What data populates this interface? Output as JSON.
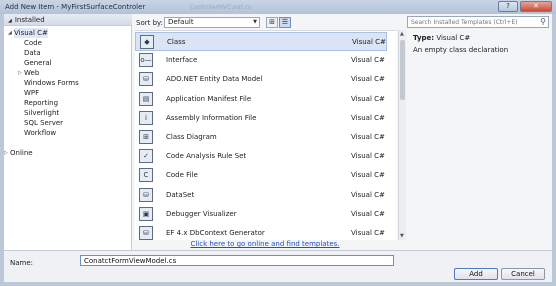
{
  "window": {
    "title": "Add New Item - MyFirstSurfaceControler",
    "background_title": "ControlerMVCunit.cs"
  },
  "left": {
    "installed_label": "Installed",
    "tree": [
      {
        "label": "Visual C#",
        "level": 1,
        "expander": "open",
        "selected": true
      },
      {
        "label": "Code",
        "level": 2,
        "expander": "none"
      },
      {
        "label": "Data",
        "level": 2,
        "expander": "none"
      },
      {
        "label": "General",
        "level": 2,
        "expander": "none"
      },
      {
        "label": "Web",
        "level": 2,
        "expander": "closed"
      },
      {
        "label": "Windows Forms",
        "level": 2,
        "expander": "none"
      },
      {
        "label": "WPF",
        "level": 2,
        "expander": "none"
      },
      {
        "label": "Reporting",
        "level": 2,
        "expander": "none"
      },
      {
        "label": "Silverlight",
        "level": 2,
        "expander": "none"
      },
      {
        "label": "SQL Server",
        "level": 2,
        "expander": "none"
      },
      {
        "label": "Workflow",
        "level": 2,
        "expander": "none"
      },
      {
        "label": "",
        "level": 0,
        "expander": "spacer"
      },
      {
        "label": "Online",
        "level": 0,
        "expander": "closed"
      }
    ]
  },
  "toolbar": {
    "sort_label": "Sort by:",
    "sort_value": "Default"
  },
  "search": {
    "placeholder": "Search Installed Templates (Ctrl+E)"
  },
  "templates": [
    {
      "name": "Class",
      "lang": "Visual C#",
      "icon": "class-icon",
      "glyph": "◆",
      "selected": true
    },
    {
      "name": "Interface",
      "lang": "Visual C#",
      "icon": "interface-icon",
      "glyph": "o—"
    },
    {
      "name": "ADO.NET Entity Data Model",
      "lang": "Visual C#",
      "icon": "entity-model-icon",
      "glyph": "⛁"
    },
    {
      "name": "Application Manifest File",
      "lang": "Visual C#",
      "icon": "manifest-icon",
      "glyph": "▤"
    },
    {
      "name": "Assembly Information File",
      "lang": "Visual C#",
      "icon": "assembly-info-icon",
      "glyph": "i"
    },
    {
      "name": "Class Diagram",
      "lang": "Visual C#",
      "icon": "class-diagram-icon",
      "glyph": "⊞"
    },
    {
      "name": "Code Analysis Rule Set",
      "lang": "Visual C#",
      "icon": "rule-set-icon",
      "glyph": "✓"
    },
    {
      "name": "Code File",
      "lang": "Visual C#",
      "icon": "code-file-icon",
      "glyph": "C"
    },
    {
      "name": "DataSet",
      "lang": "Visual C#",
      "icon": "dataset-icon",
      "glyph": "⛁"
    },
    {
      "name": "Debugger Visualizer",
      "lang": "Visual C#",
      "icon": "debugger-visualizer-icon",
      "glyph": "▣"
    },
    {
      "name": "EF 4.x DbContext Generator",
      "lang": "Visual C#",
      "icon": "ef-generator-icon",
      "glyph": "⛁"
    }
  ],
  "detail": {
    "type_label": "Type:",
    "type_value": "Visual C#",
    "description": "An empty class declaration"
  },
  "online_link": "Click here to go online and find templates.",
  "name_field": {
    "label": "Name:",
    "value": "ConatctFormViewModel.cs"
  },
  "buttons": {
    "add": "Add",
    "cancel": "Cancel"
  }
}
